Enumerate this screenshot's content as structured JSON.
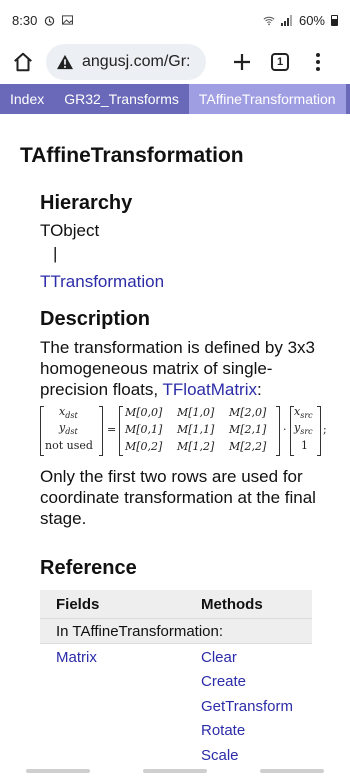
{
  "status": {
    "time": "8:30",
    "battery": "60%"
  },
  "browser": {
    "url": "angusj.com/Gr:",
    "tab_count": "1"
  },
  "breadcrumb": [
    "Index",
    "GR32_Transforms",
    "TAffineTransformation"
  ],
  "page": {
    "title": "TAffineTransformation",
    "hierarchy": {
      "heading": "Hierarchy",
      "root": "TObject",
      "pipe": "|",
      "child": "TTransformation"
    },
    "description": {
      "heading": "Description",
      "para1_text": "The transformation is defined by 3x3 homogeneous matrix of single-precision floats, ",
      "para1_link": "TFloatMatrix",
      "para1_end": ":",
      "para2": "Only the first two rows are used for coordinate transformation at the final stage."
    },
    "equation": {
      "left_vector": [
        "x",
        "y",
        "not used"
      ],
      "left_sub": "dst",
      "equals": "=",
      "matrix": [
        [
          "M[0,0]",
          "M[1,0]",
          "M[2,0]"
        ],
        [
          "M[0,1]",
          "M[1,1]",
          "M[2,1]"
        ],
        [
          "M[0,2]",
          "M[1,2]",
          "M[2,2]"
        ]
      ],
      "dot": "·",
      "right_vector": [
        "x",
        "y",
        "1"
      ],
      "right_sub": "src",
      "trailing": ";"
    },
    "reference": {
      "heading": "Reference",
      "fields_header": "Fields",
      "methods_header": "Methods",
      "group_label": "In TAffineTransformation:",
      "fields": [
        "Matrix"
      ],
      "methods": [
        "Clear",
        "Create",
        "GetTransform",
        "Rotate",
        "Scale"
      ]
    }
  }
}
